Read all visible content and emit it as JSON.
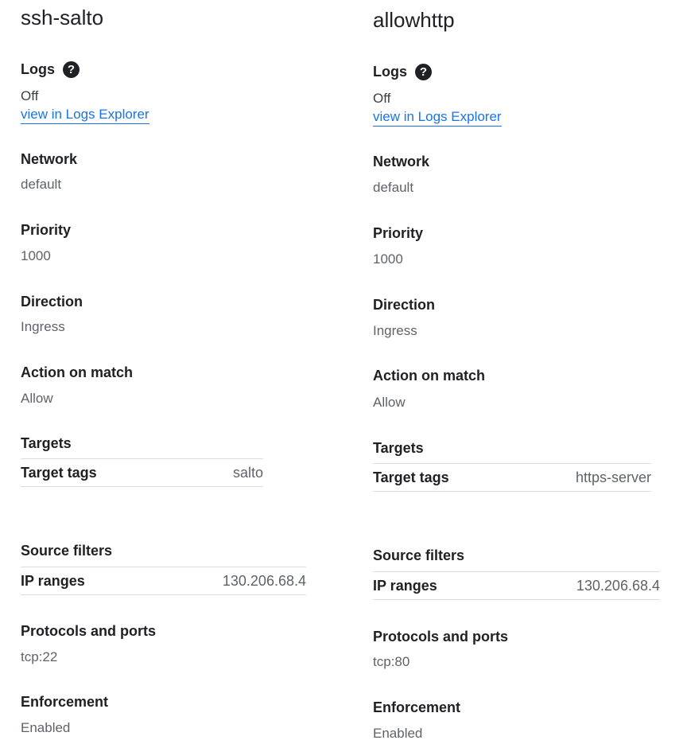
{
  "rules": [
    {
      "name": "ssh-salto",
      "logs_label": "Logs",
      "logs_help_icon": "help-circle-icon",
      "logs_value": "Off",
      "logs_link": "view in Logs Explorer",
      "network_label": "Network",
      "network_value": "default",
      "priority_label": "Priority",
      "priority_value": "1000",
      "direction_label": "Direction",
      "direction_value": "Ingress",
      "action_label": "Action on match",
      "action_value": "Allow",
      "targets_label": "Targets",
      "target_tags_label": "Target tags",
      "target_tags_value": "salto",
      "source_filters_label": "Source filters",
      "ip_ranges_label": "IP ranges",
      "ip_ranges_value": "130.206.68.4",
      "protocols_label": "Protocols and ports",
      "protocols_value": "tcp:22",
      "enforcement_label": "Enforcement",
      "enforcement_value": "Enabled"
    },
    {
      "name": "allowhttp",
      "logs_label": "Logs",
      "logs_help_icon": "help-circle-icon",
      "logs_value": "Off",
      "logs_link": "view in Logs Explorer",
      "network_label": "Network",
      "network_value": "default",
      "priority_label": "Priority",
      "priority_value": "1000",
      "direction_label": "Direction",
      "direction_value": "Ingress",
      "action_label": "Action on match",
      "action_value": "Allow",
      "targets_label": "Targets",
      "target_tags_label": "Target tags",
      "target_tags_value": "https-server",
      "source_filters_label": "Source filters",
      "ip_ranges_label": "IP ranges",
      "ip_ranges_value": "130.206.68.4",
      "protocols_label": "Protocols and ports",
      "protocols_value": "tcp:80",
      "enforcement_label": "Enforcement",
      "enforcement_value": "Enabled"
    }
  ],
  "colors": {
    "text": "#202124",
    "secondary_text": "#5f6368",
    "link": "#1a73e8",
    "divider": "#dadce0"
  }
}
